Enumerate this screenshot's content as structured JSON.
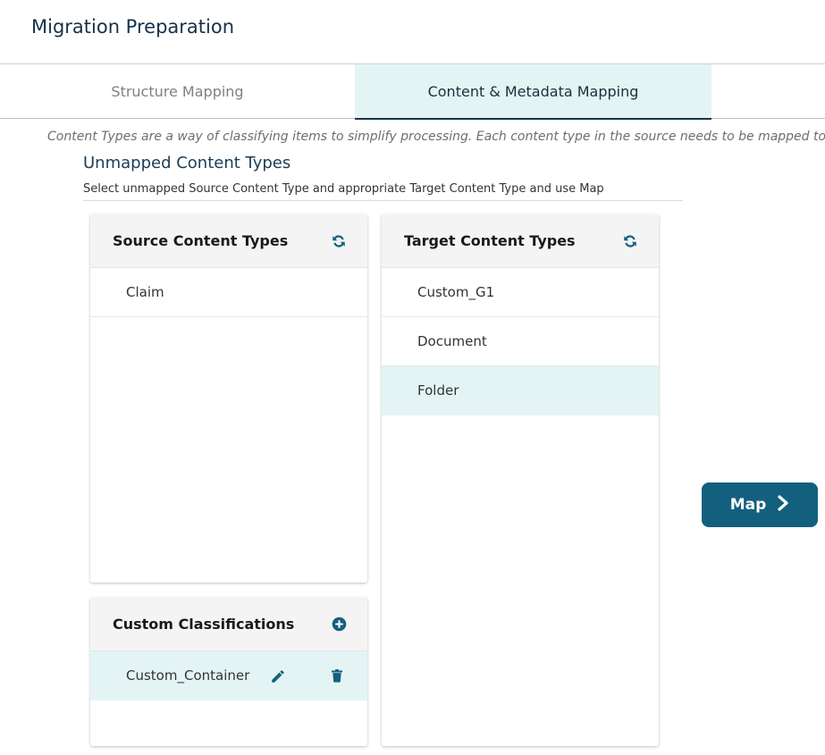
{
  "page": {
    "title": "Migration Preparation"
  },
  "tabs": [
    {
      "label": "Structure Mapping",
      "active": false
    },
    {
      "label": "Content & Metadata Mapping",
      "active": true
    }
  ],
  "intro_text": "Content Types are a way of classifying items to simplify processing.  Each content type in the source needs to be mapped to a suitable",
  "section": {
    "title": "Unmapped Content Types",
    "subtitle": "Select unmapped Source Content Type and appropriate Target Content Type and use Map"
  },
  "source_panel": {
    "title": "Source Content Types",
    "header_icon": "refresh-icon",
    "items": [
      {
        "label": "Claim",
        "selected": false
      }
    ]
  },
  "target_panel": {
    "title": "Target Content Types",
    "header_icon": "refresh-icon",
    "items": [
      {
        "label": "Custom_G1",
        "selected": false
      },
      {
        "label": "Document",
        "selected": false
      },
      {
        "label": "Folder",
        "selected": true
      }
    ]
  },
  "custom_panel": {
    "title": "Custom Classifications",
    "header_icon": "add-circle-icon",
    "items": [
      {
        "label": "Custom_Container",
        "selected": true,
        "actions": [
          "edit-icon",
          "delete-icon"
        ]
      }
    ]
  },
  "map_button": {
    "label": "Map",
    "icon": "chevron-right-icon"
  },
  "colors": {
    "accent": "#13607e",
    "selected_bg": "#e4f4f4",
    "title": "#15324a"
  }
}
